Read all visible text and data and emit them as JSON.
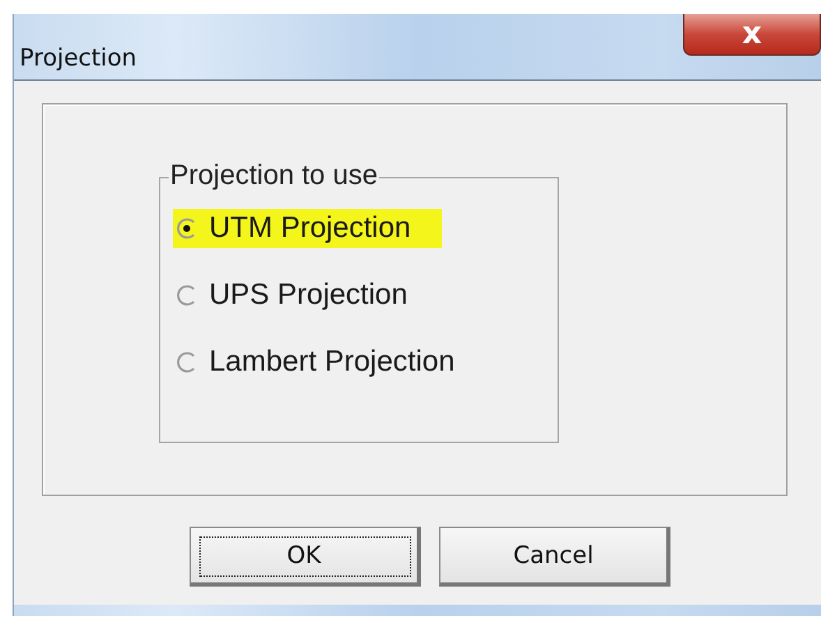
{
  "window": {
    "title": "Projection",
    "close": "x"
  },
  "group": {
    "legend": "Projection to use",
    "options": [
      {
        "label": "UTM Projection",
        "selected": true,
        "highlighted": true
      },
      {
        "label": "UPS Projection",
        "selected": false,
        "highlighted": false
      },
      {
        "label": "Lambert Projection",
        "selected": false,
        "highlighted": false
      }
    ]
  },
  "buttons": [
    {
      "label": "OK",
      "default": true
    },
    {
      "label": "Cancel",
      "default": false
    }
  ]
}
